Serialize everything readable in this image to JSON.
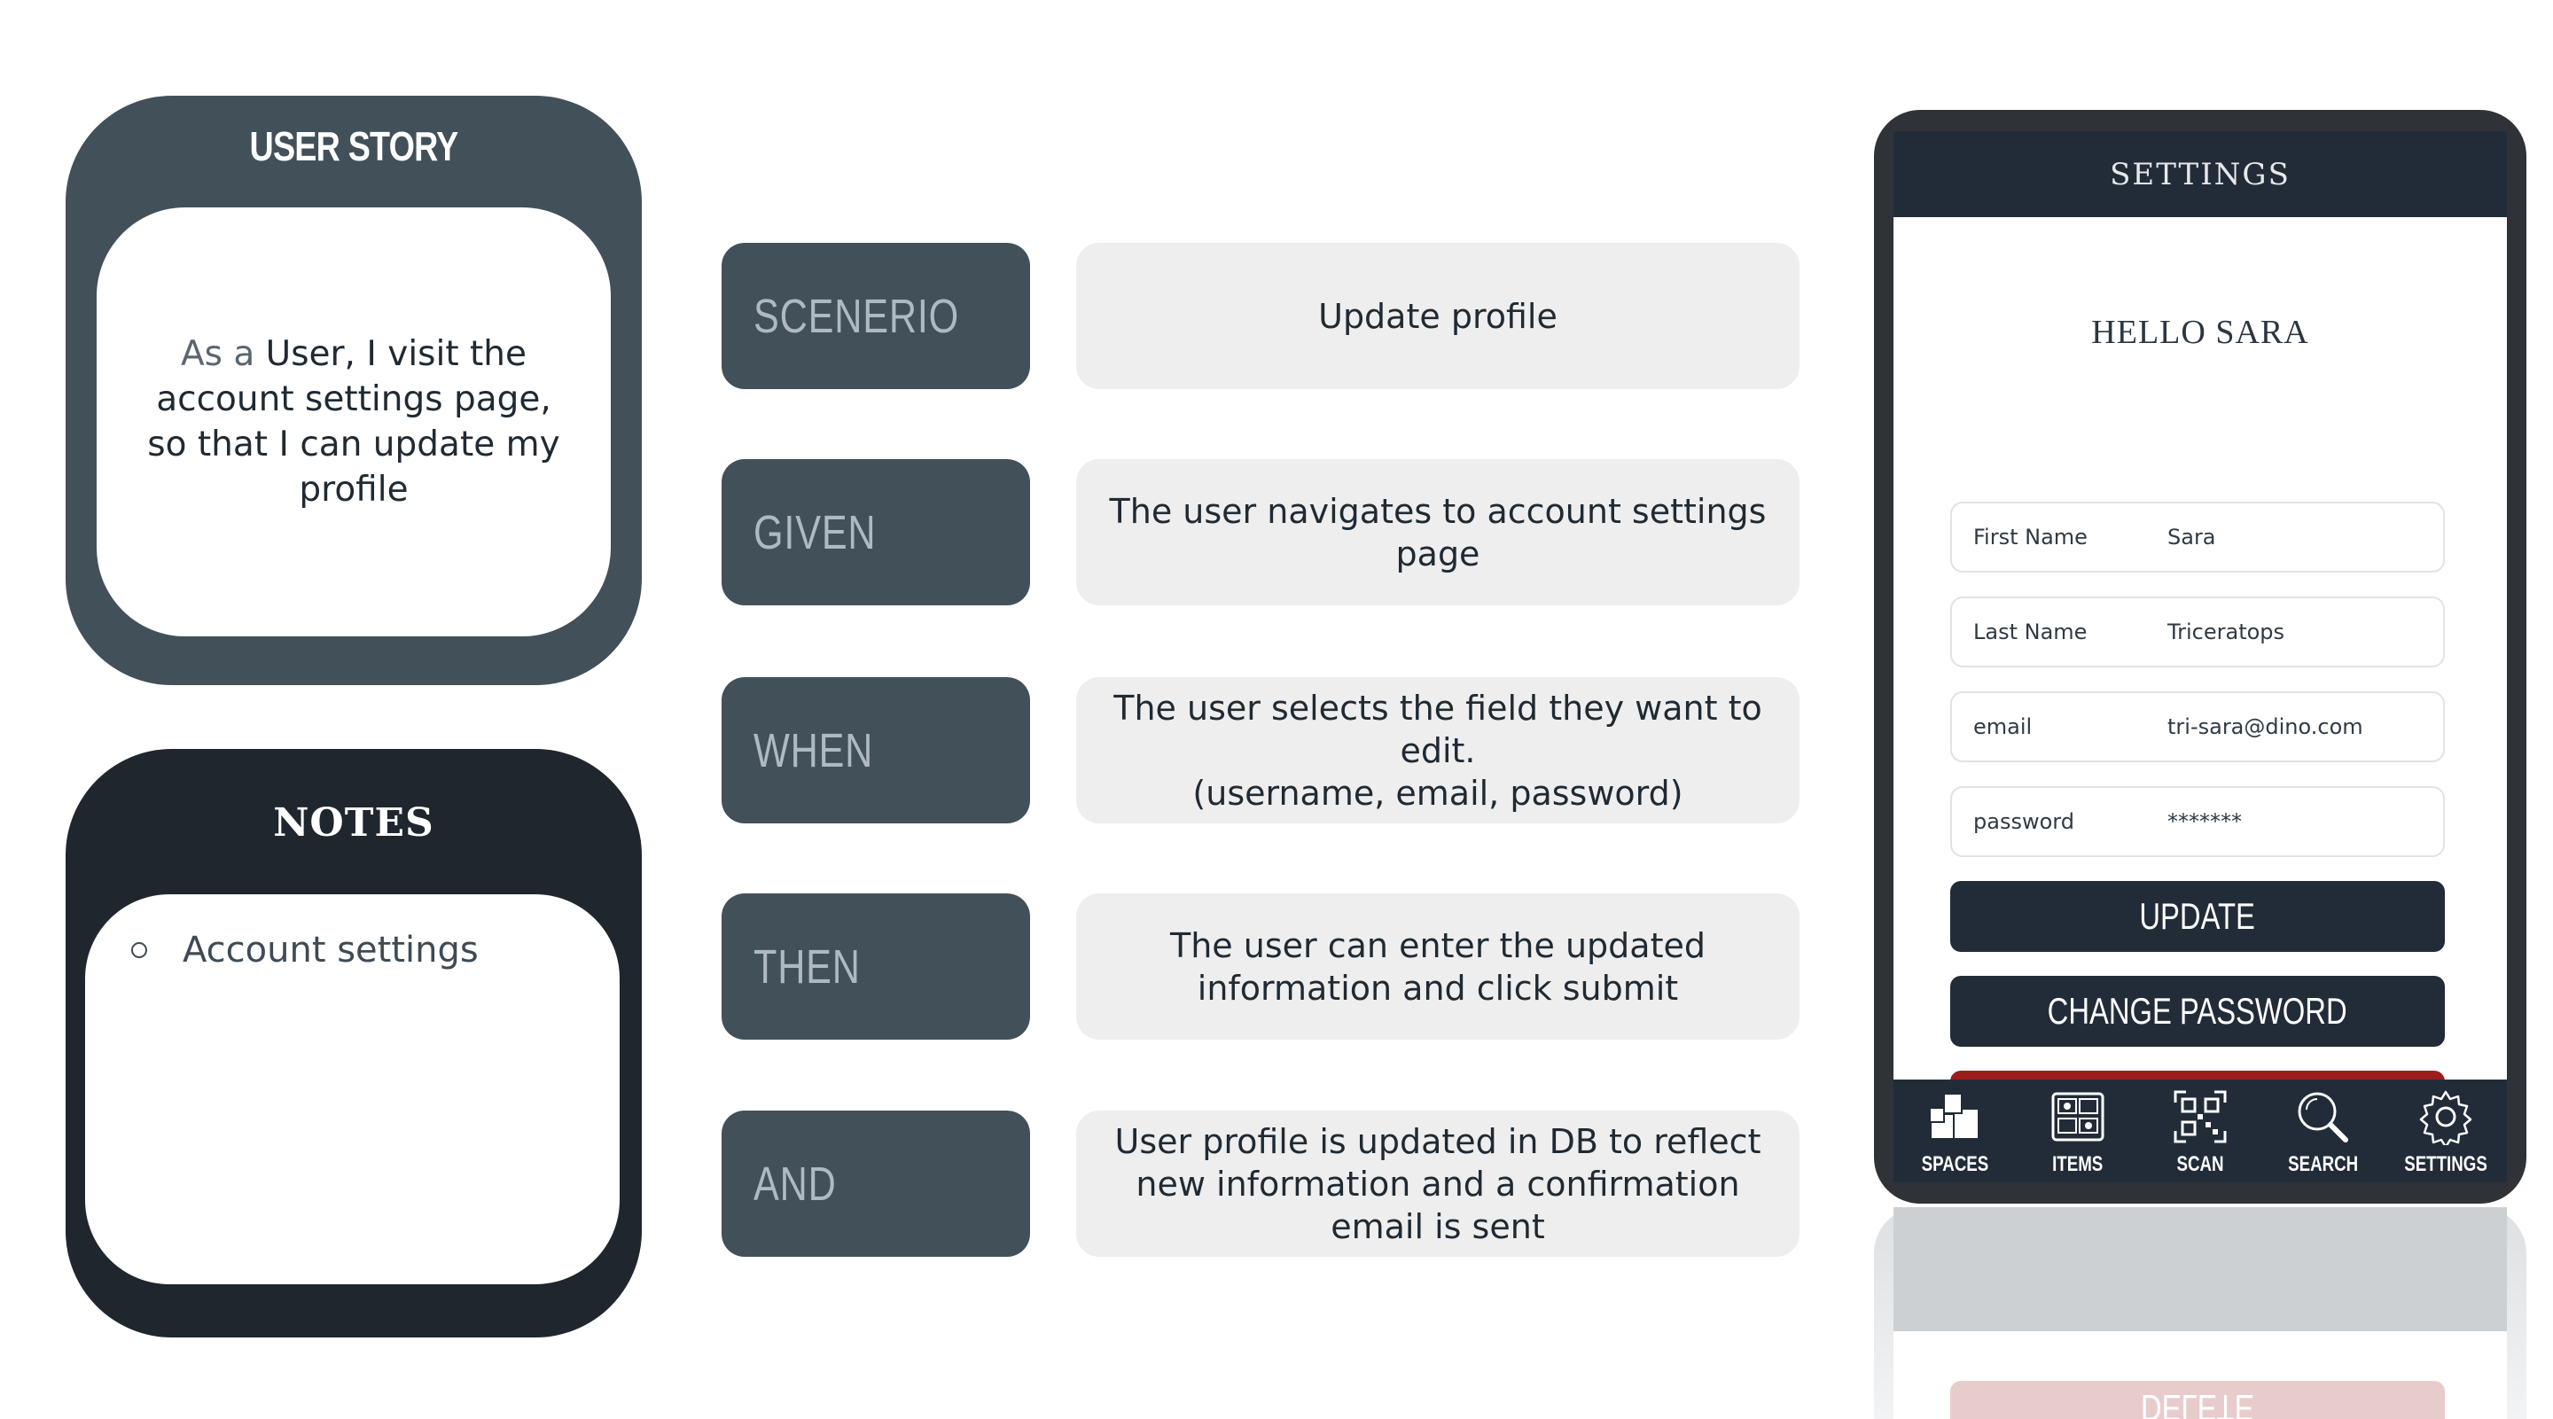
{
  "story": {
    "title": "USER STORY",
    "text_prefix": "As a",
    "text_body": " User, I visit the account settings page, so that I can update my profile"
  },
  "notes": {
    "title": "NOTES",
    "items": [
      "Account settings"
    ]
  },
  "rows": [
    {
      "label": "SCENERIO",
      "text": "Update profile"
    },
    {
      "label": "GIVEN",
      "text": "The user navigates to account settings page"
    },
    {
      "label": "WHEN",
      "text": "The user selects the field they want to edit.\n(username, email, password)"
    },
    {
      "label": "THEN",
      "text": "The user can enter the updated information and click submit"
    },
    {
      "label": "AND",
      "text": "User profile is updated in DB to reflect new information and a confirmation email is sent"
    }
  ],
  "phone": {
    "header_title": "SETTINGS",
    "greeting": "HELLO SARA",
    "fields": [
      {
        "label": "First Name",
        "value": "Sara"
      },
      {
        "label": "Last Name",
        "value": "Triceratops"
      },
      {
        "label": "email",
        "value": "tri-sara@dino.com"
      },
      {
        "label": "password",
        "value": "*******"
      }
    ],
    "buttons": {
      "update": "UPDATE",
      "change_password": "CHANGE PASSWORD",
      "delete": "DELETE"
    },
    "tabs": [
      {
        "label": "SPACES",
        "icon": "spaces-icon"
      },
      {
        "label": "ITEMS",
        "icon": "items-icon"
      },
      {
        "label": "SCAN",
        "icon": "qr-scan-icon"
      },
      {
        "label": "SEARCH",
        "icon": "search-icon"
      },
      {
        "label": "SETTINGS",
        "icon": "gear-icon"
      }
    ]
  },
  "colors": {
    "story_bg": "#425059",
    "notes_bg": "#1f262d",
    "label_bg": "#425059",
    "text_box_bg": "#eeeeee",
    "phone_header": "#222c38",
    "delete_red": "#9b1e1b"
  }
}
